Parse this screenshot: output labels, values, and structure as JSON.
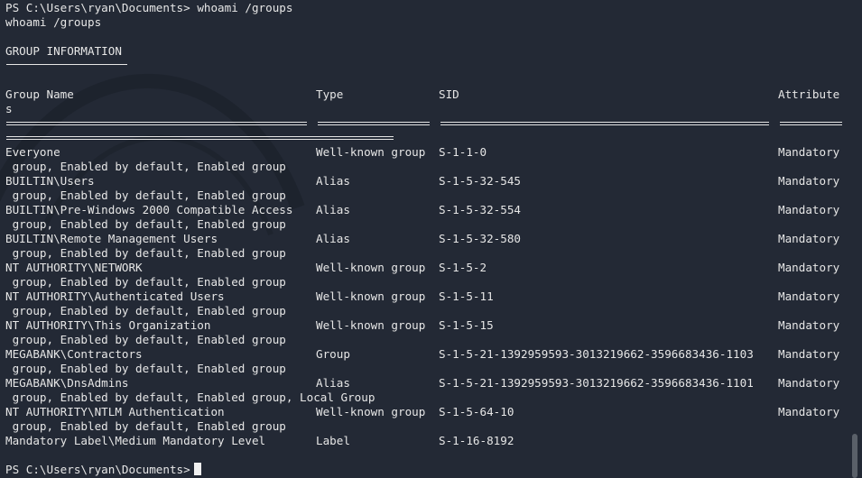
{
  "terminal": {
    "prompt": "PS C:\\Users\\ryan\\Documents>",
    "command": "whoami /groups",
    "echo": "whoami /groups",
    "section_title": "GROUP INFORMATION",
    "headers": {
      "name": "Group Name",
      "type": "Type",
      "sid": "SID",
      "attr": "Attribute",
      "attr_wrap": "s"
    },
    "rows": [
      {
        "name": "Everyone",
        "type": "Well-known group",
        "sid": "S-1-1-0",
        "attr": "Mandatory",
        "cont": " group, Enabled by default, Enabled group"
      },
      {
        "name": "BUILTIN\\Users",
        "type": "Alias",
        "sid": "S-1-5-32-545",
        "attr": "Mandatory",
        "cont": " group, Enabled by default, Enabled group"
      },
      {
        "name": "BUILTIN\\Pre-Windows 2000 Compatible Access",
        "type": "Alias",
        "sid": "S-1-5-32-554",
        "attr": "Mandatory",
        "cont": " group, Enabled by default, Enabled group"
      },
      {
        "name": "BUILTIN\\Remote Management Users",
        "type": "Alias",
        "sid": "S-1-5-32-580",
        "attr": "Mandatory",
        "cont": " group, Enabled by default, Enabled group"
      },
      {
        "name": "NT AUTHORITY\\NETWORK",
        "type": "Well-known group",
        "sid": "S-1-5-2",
        "attr": "Mandatory",
        "cont": " group, Enabled by default, Enabled group"
      },
      {
        "name": "NT AUTHORITY\\Authenticated Users",
        "type": "Well-known group",
        "sid": "S-1-5-11",
        "attr": "Mandatory",
        "cont": " group, Enabled by default, Enabled group"
      },
      {
        "name": "NT AUTHORITY\\This Organization",
        "type": "Well-known group",
        "sid": "S-1-5-15",
        "attr": "Mandatory",
        "cont": " group, Enabled by default, Enabled group"
      },
      {
        "name": "MEGABANK\\Contractors",
        "type": "Group",
        "sid": "S-1-5-21-1392959593-3013219662-3596683436-1103",
        "attr": "Mandatory",
        "cont": " group, Enabled by default, Enabled group"
      },
      {
        "name": "MEGABANK\\DnsAdmins",
        "type": "Alias",
        "sid": "S-1-5-21-1392959593-3013219662-3596683436-1101",
        "attr": "Mandatory",
        "cont": " group, Enabled by default, Enabled group, Local Group"
      },
      {
        "name": "NT AUTHORITY\\NTLM Authentication",
        "type": "Well-known group",
        "sid": "S-1-5-64-10",
        "attr": "Mandatory",
        "cont": " group, Enabled by default, Enabled group"
      },
      {
        "name": "Mandatory Label\\Medium Mandatory Level",
        "type": "Label",
        "sid": "S-1-16-8192",
        "attr": "",
        "cont": null
      }
    ]
  }
}
